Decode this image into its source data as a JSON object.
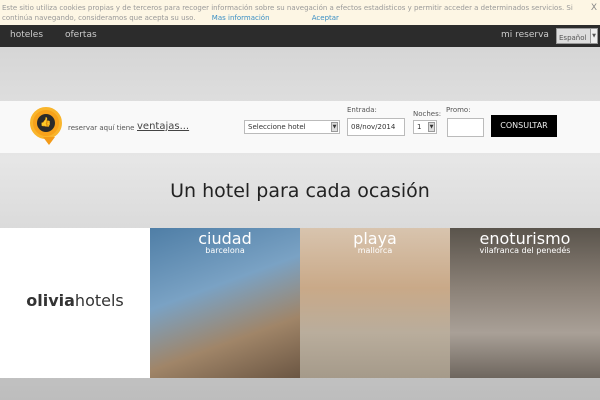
{
  "cookie": {
    "text": "Este sitio utiliza cookies propias y de terceros para recoger información sobre su navegación a efectos estadísticos y permitir acceder a determinados servicios. Si continúa navegando, consideramos que acepta su uso.",
    "more": "Mas información",
    "accept": "Aceptar",
    "close": "X"
  },
  "nav": {
    "hotels": "hoteles",
    "offers": "ofertas",
    "my_booking": "mi reserva",
    "language": "Español"
  },
  "booking": {
    "promo_text": "reservar aquí tiene",
    "promo_link": "ventajas...",
    "hotel_select": "Seleccione hotel",
    "entry_label": "Entrada:",
    "entry_value": "08/nov/2014",
    "nights_label": "Noches:",
    "nights_value": "1",
    "promo_label": "Promo:",
    "promo_value": "",
    "submit": "CONSULTAR"
  },
  "headline": "Un hotel para cada ocasión",
  "logo": {
    "bold": "olivia",
    "light": "hotels"
  },
  "tiles": [
    {
      "title": "ciudad",
      "subtitle": "barcelona"
    },
    {
      "title": "playa",
      "subtitle": "mallorca"
    },
    {
      "title": "enoturismo",
      "subtitle": "vilafranca del penedés"
    }
  ]
}
